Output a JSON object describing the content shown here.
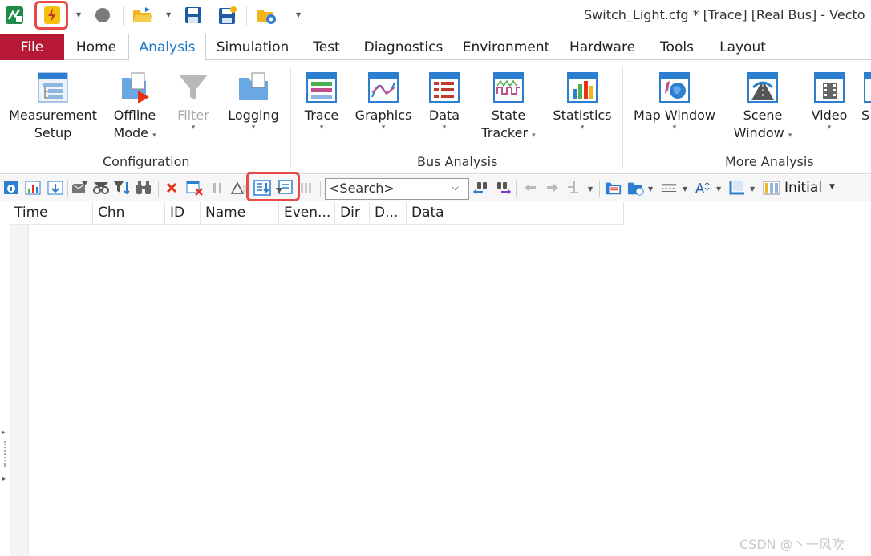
{
  "window": {
    "title": "Switch_Light.cfg * [Trace] [Real Bus] - Vecto"
  },
  "quick_access": {
    "items": [
      "app-logo-icon",
      "start-measurement-icon",
      "stop-measurement-icon",
      "open-config-icon",
      "save-icon",
      "save-as-icon",
      "new-config-icon",
      "customize-icon"
    ]
  },
  "tabs": {
    "file": "File",
    "items": [
      "Home",
      "Analysis",
      "Simulation",
      "Test",
      "Diagnostics",
      "Environment",
      "Hardware",
      "Tools",
      "Layout"
    ],
    "active": "Analysis"
  },
  "ribbon": {
    "configuration": {
      "label": "Configuration",
      "measurement_setup": [
        "Measurement",
        "Setup"
      ],
      "offline_mode": [
        "Offline",
        "Mode"
      ],
      "filter": "Filter",
      "logging": "Logging"
    },
    "bus_analysis": {
      "label": "Bus Analysis",
      "trace": "Trace",
      "graphics": "Graphics",
      "data": "Data",
      "state_tracker": [
        "State",
        "Tracker"
      ],
      "statistics": "Statistics"
    },
    "more_analysis": {
      "label": "More Analysis",
      "map_window": "Map Window",
      "scene_window": [
        "Scene",
        "Window"
      ],
      "video": "Video",
      "cut": "S"
    }
  },
  "toolbar": {
    "search_placeholder": "<Search>",
    "initial_label": "Initial"
  },
  "trace_table": {
    "columns": [
      "Time",
      "Chn",
      "ID",
      "Name",
      "Even...",
      "Dir",
      "D...",
      "Data"
    ]
  },
  "watermark": "CSDN @丶一风吹",
  "colors": {
    "file_tab": "#b71836",
    "active_tab_text": "#1f7ac8",
    "highlight": "#e84a4a"
  }
}
